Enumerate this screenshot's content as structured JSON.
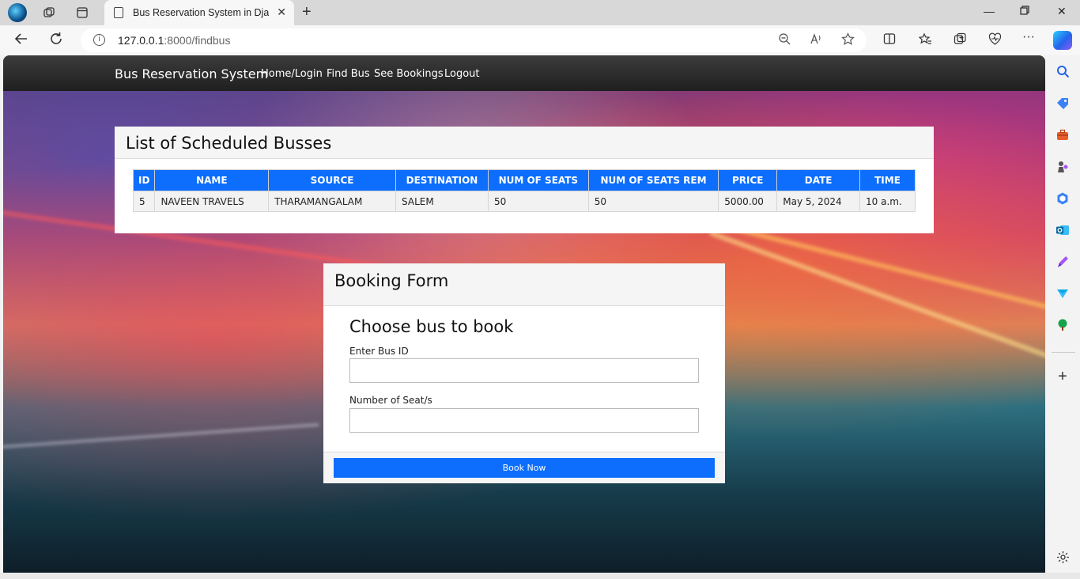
{
  "browser": {
    "tab_title": "Bus Reservation System in Django",
    "url_host": "127.0.0.1",
    "url_rest": ":8000/findbus",
    "info_symbol": "i"
  },
  "navbar": {
    "brand": "Bus Reservation System",
    "links": [
      "Home/Login",
      "Find Bus",
      "See Bookings",
      "Logout"
    ]
  },
  "bus_list": {
    "title": "List of Scheduled Busses",
    "columns": [
      "ID",
      "NAME",
      "SOURCE",
      "DESTINATION",
      "NUM OF SEATS",
      "NUM OF SEATS REM",
      "PRICE",
      "DATE",
      "TIME"
    ],
    "rows": [
      [
        "5",
        "NAVEEN TRAVELS",
        "THARAMANGALAM",
        "SALEM",
        "50",
        "50",
        "5000.00",
        "May 5, 2024",
        "10 a.m."
      ]
    ]
  },
  "booking_form": {
    "title": "Booking Form",
    "subtitle": "Choose bus to book",
    "bus_id_label": "Enter Bus ID",
    "bus_id_value": "",
    "seats_label": "Number of Seat/s",
    "seats_value": "",
    "submit_label": "Book Now"
  },
  "colors": {
    "primary": "#0d6efd",
    "navbar": "#2a2a2a"
  }
}
